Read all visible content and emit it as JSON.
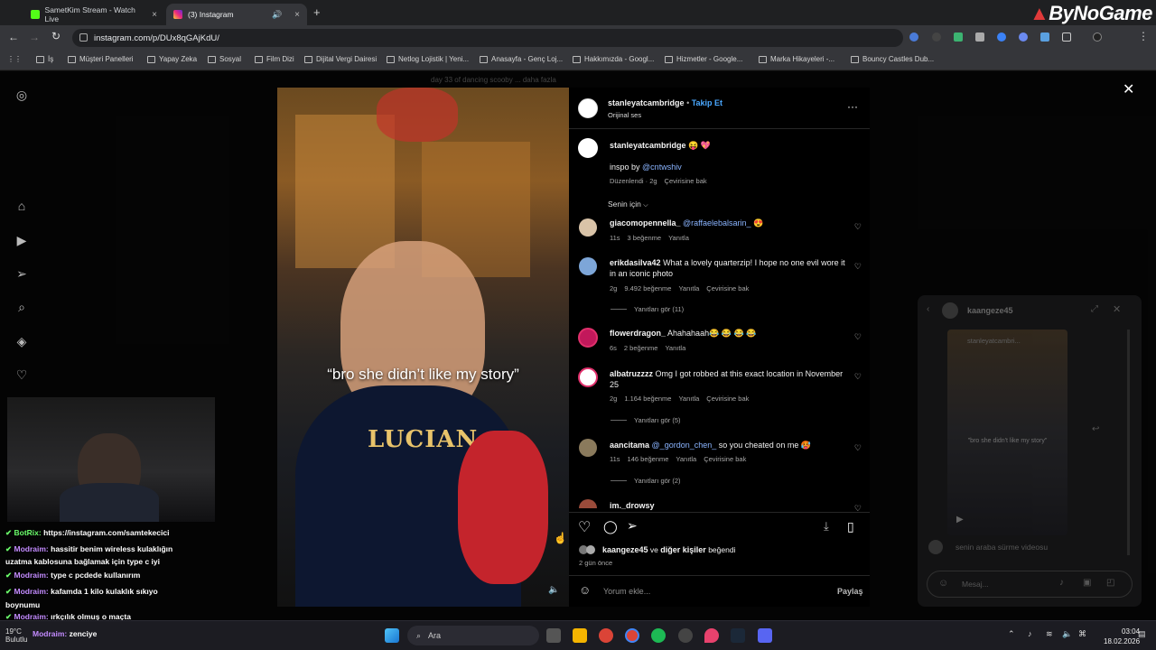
{
  "browser": {
    "tabs": [
      {
        "title": "SametKim Stream - Watch Live"
      },
      {
        "title": "(3) Instagram"
      }
    ],
    "url": "instagram.com/p/DUx8qGAjKdU/",
    "bookmarks": [
      "İş",
      "Müşteri Panelleri",
      "Yapay Zeka",
      "Sosyal",
      "Film Dizi",
      "Dijital Vergi Dairesi",
      "Netlog Lojistik | Yeni...",
      "Anasayfa - Genç Loj...",
      "Hakkımızda - Googl...",
      "Hizmetler - Google...",
      "Marka Hikayeleri -...",
      "Bouncy Castles Dub..."
    ]
  },
  "watermark": "ByNoGame",
  "top_caption": "day 33 of dancing scooby ... daha fazla",
  "post": {
    "author": "stanleyatcambridge",
    "follow": "Takip Et",
    "audio": "Orijinal ses",
    "overlay_text": "“bro she didn’t like my story”",
    "caption": {
      "author": "stanleyatcambridge",
      "emoji": "😝 💖",
      "text_prefix": "inspo by",
      "mention": "@cntwshiv",
      "meta": "Düzenlendi · 2g",
      "translate": "Çevirisine bak"
    },
    "sort_label": "Senin için",
    "comments": [
      {
        "user": "giacomopennella_",
        "mention": "@raffaelebalsarin_",
        "text": "😍",
        "age": "11s",
        "likes": "3 beğenme",
        "reply": "Yanıtla",
        "translate": ""
      },
      {
        "user": "erikdasilva42",
        "mention": "",
        "text": "What a lovely quarterzip! I hope no one evil wore it in an iconic photo",
        "age": "2g",
        "likes": "9.492 beğenme",
        "reply": "Yanıtla",
        "translate": "Çevirisine bak",
        "replies": "Yanıtları gör (11)"
      },
      {
        "user": "flowerdragon_",
        "mention": "",
        "text": "Ahahahaah😂 😂 😂 😂",
        "age": "6s",
        "likes": "2 beğenme",
        "reply": "Yanıtla",
        "translate": ""
      },
      {
        "user": "albatruzzzz",
        "mention": "",
        "text": "Omg I got robbed at this exact location in November 25",
        "age": "2g",
        "likes": "1.164 beğenme",
        "reply": "Yanıtla",
        "translate": "Çevirisine bak",
        "replies": "Yanıtları gör (5)"
      },
      {
        "user": "aancitama",
        "mention": "@_gordon_chen_",
        "text": "so you cheated on me 🥵",
        "age": "11s",
        "likes": "146 beğenme",
        "reply": "Yanıtla",
        "translate": "Çevirisine bak",
        "replies": "Yanıtları gör (2)"
      },
      {
        "user": "im._drowsy",
        "mention": "",
        "text": "",
        "age": "",
        "likes": "",
        "reply": "",
        "translate": ""
      }
    ],
    "liked_by": {
      "user": "kaangeze45",
      "middle": "ve",
      "others": "diğer kişiler",
      "suffix": "beğendi"
    },
    "time_ago": "2 gün önce",
    "comment_placeholder": "Yorum ekle...",
    "share_label": "Paylaş"
  },
  "dm": {
    "user": "kaangeze45",
    "shared_author": "stanleyatcambri...",
    "shared_caption": "\"bro she didn't like my story\"",
    "last_message": "senin araba sürme videosu",
    "placeholder": "Mesaj..."
  },
  "chat": [
    {
      "user": "BotRix:",
      "text": "https://instagram.com/samtekecici"
    },
    {
      "user": "Modraim:",
      "text": "hassitir benim wireless kulaklığın"
    },
    {
      "user": "",
      "text": "uzatma kablosuna bağlamak için type c iyi"
    },
    {
      "user": "Modraim:",
      "text": "type c pcdede kullanırım"
    },
    {
      "user": "Modraim:",
      "text": "kafamda 1 kilo kulaklık sıkıyo"
    },
    {
      "user": "",
      "text": "boynumu"
    },
    {
      "user": "Modraim:",
      "text": "ırkçılık olmuş o maçta"
    },
    {
      "user": "Modraim:",
      "text": "zenciye"
    }
  ],
  "taskbar": {
    "search": "Ara",
    "time": "03:04",
    "date": "18.02.2026",
    "weather": "19°C",
    "weather_sub": "Bulutlu"
  },
  "colors": {
    "accent": "#0095f6",
    "link": "#8ab4ff",
    "chat_name": "#c38bff"
  }
}
